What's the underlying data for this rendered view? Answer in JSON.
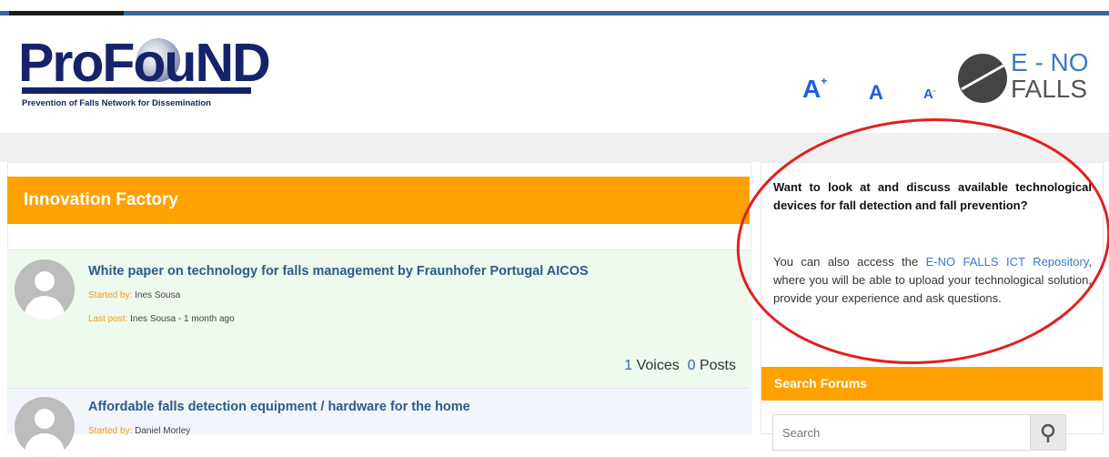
{
  "header": {
    "logo": {
      "text": "ProFouND",
      "subtitle": "Prevention of Falls Network for Dissemination"
    },
    "font_size_controls": [
      {
        "label": "A",
        "icon": "font-increase-icon"
      },
      {
        "label": "A",
        "icon": "font-reset-icon"
      },
      {
        "label": "A",
        "icon": "font-decrease-icon"
      }
    ],
    "partner_logo": {
      "line1": "E - NO",
      "line2": "FALLS"
    }
  },
  "forum": {
    "title": "Innovation Factory",
    "topics": [
      {
        "title": "White paper on technology for falls management by Fraunhofer Portugal AICOS",
        "started_by_label": "Started by:",
        "started_by": "Ines Sousa",
        "last_post_label": "Last post:",
        "last_post": "Ines Sousa - 1 month ago",
        "voices_count": "1",
        "voices_label": "Voices",
        "posts_count": "0",
        "posts_label": "Posts"
      },
      {
        "title": "Affordable falls detection equipment / hardware for the home",
        "started_by_label": "Started by:",
        "started_by": "Daniel Morley"
      }
    ]
  },
  "sidebar": {
    "question": "Want to look at and discuss available technological devices for fall detection and fall prevention?",
    "paragraph_before": "You can also access the ",
    "link_text": "E-NO FALLS ICT Repository",
    "paragraph_after": ", where you will be able to upload your technological solution, provide your experience and ask questions.",
    "search_title": "Search Forums",
    "search_placeholder": "Search",
    "search_icon": "search-icon"
  },
  "colors": {
    "accent_orange": "#ffa200",
    "logo_navy": "#16236b",
    "link_blue": "#2d5a8c",
    "font_control_blue": "#1e5fd6",
    "annotation_red": "#e02020"
  }
}
